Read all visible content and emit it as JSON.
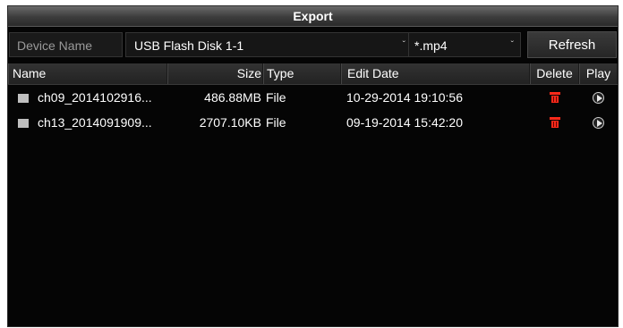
{
  "dialog": {
    "title": "Export"
  },
  "toolbar": {
    "device_label": "Device Name",
    "device_value": "USB Flash Disk 1-1",
    "type_value": "*.mp4",
    "refresh_label": "Refresh",
    "caret_glyph": "ˇ"
  },
  "table": {
    "columns": {
      "name": "Name",
      "size": "Size",
      "type": "Type",
      "edit_date": "Edit Date",
      "delete": "Delete",
      "play": "Play"
    },
    "rows": [
      {
        "name": "ch09_2014102916...",
        "size": "486.88MB",
        "type": "File",
        "edit_date": "10-29-2014 19:10:56"
      },
      {
        "name": "ch13_2014091909...",
        "size": "2707.10KB",
        "type": "File",
        "edit_date": "09-19-2014 15:42:20"
      }
    ],
    "icons": {
      "file": "file-icon",
      "delete": "trash-icon",
      "play": "play-icon"
    }
  },
  "colors": {
    "background": "#050505",
    "delete_icon": "#ff2a1a",
    "label_muted": "#9a9a9a"
  }
}
